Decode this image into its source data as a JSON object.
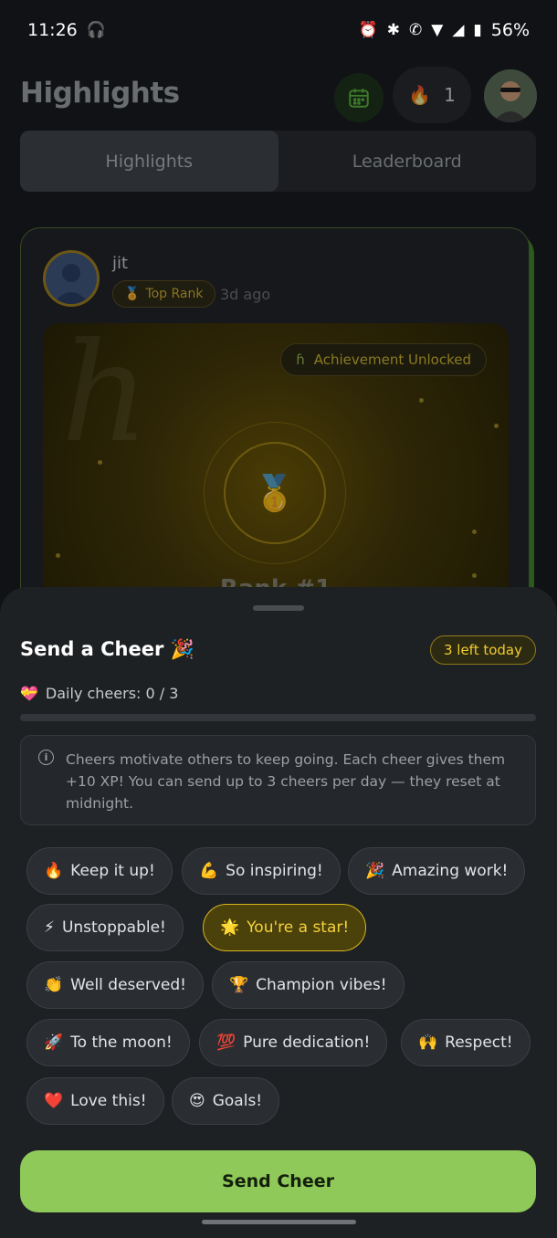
{
  "status_bar": {
    "time": "11:26",
    "battery": "56%"
  },
  "header": {
    "title": "Highlights",
    "streak_count": "1"
  },
  "tabs": [
    {
      "label": "Highlights",
      "active": true
    },
    {
      "label": "Leaderboard",
      "active": false
    }
  ],
  "highlight_card": {
    "user_name": "jit",
    "rank_badge": "Top Rank",
    "posted_ago": "3d ago",
    "achievement_badge": "Achievement Unlocked",
    "achievement_title": "Rank #1"
  },
  "cheer_sheet": {
    "title": "Send a Cheer 🎉",
    "left_badge": "3 left today",
    "daily_label": "Daily cheers: 0 / 3",
    "daily_used": 0,
    "daily_total": 3,
    "info_text": "Cheers motivate others to keep going. Each cheer gives them +10 XP! You can send up to 3 cheers per day — they reset at midnight.",
    "options": [
      {
        "emoji": "🔥",
        "label": "Keep it up!",
        "selected": false
      },
      {
        "emoji": "💪",
        "label": "So inspiring!",
        "selected": false
      },
      {
        "emoji": "🎉",
        "label": "Amazing work!",
        "selected": false
      },
      {
        "emoji": "⚡",
        "label": "Unstoppable!",
        "selected": false
      },
      {
        "emoji": "🌟",
        "label": "You're a star!",
        "selected": true
      },
      {
        "emoji": "👏",
        "label": "Well deserved!",
        "selected": false
      },
      {
        "emoji": "🏆",
        "label": "Champion vibes!",
        "selected": false
      },
      {
        "emoji": "🚀",
        "label": "To the moon!",
        "selected": false
      },
      {
        "emoji": "💯",
        "label": "Pure dedication!",
        "selected": false
      },
      {
        "emoji": "🙌",
        "label": "Respect!",
        "selected": false
      },
      {
        "emoji": "❤️",
        "label": "Love this!",
        "selected": false
      },
      {
        "emoji": "😍",
        "label": "Goals!",
        "selected": false
      }
    ],
    "send_button": "Send Cheer"
  },
  "colors": {
    "accent_green": "#8fc95a",
    "selected_gold": "#f4d23a",
    "sheet_bg": "#1e2124"
  }
}
